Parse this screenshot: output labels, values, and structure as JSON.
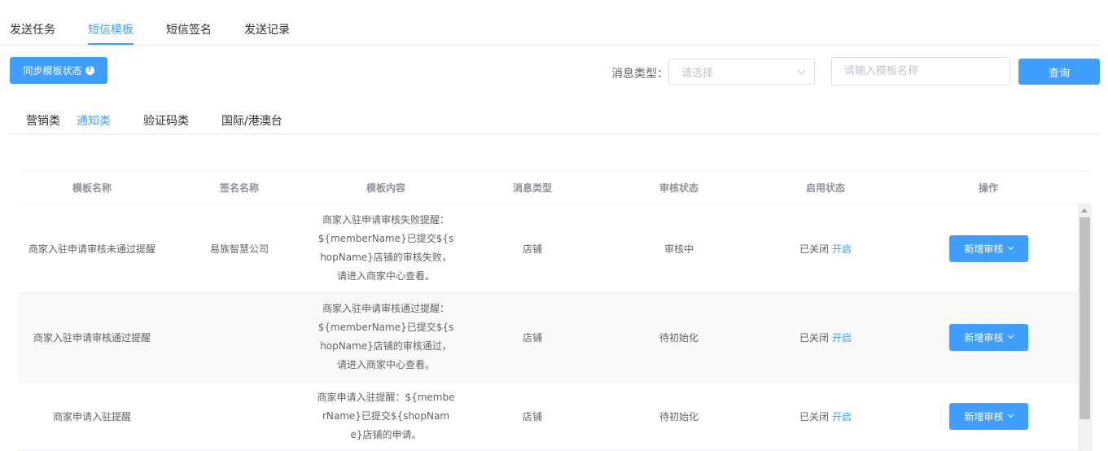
{
  "top_tabs": {
    "items": [
      "发送任务",
      "短信模板",
      "短信签名",
      "发送记录"
    ],
    "active": "短信模板"
  },
  "toolbar": {
    "sync_label": "同步模板状态",
    "sync_help_icon": "question-circle-icon",
    "type_label": "消息类型：",
    "type_placeholder": "请选择",
    "name_placeholder": "请输入模板名称",
    "query_label": "查询"
  },
  "sub_tabs": {
    "items": [
      "营销类",
      "通知类",
      "验证码类",
      "国际/港澳台"
    ],
    "active": "通知类"
  },
  "table": {
    "headers": [
      "模板名称",
      "签名名称",
      "模板内容",
      "消息类型",
      "审核状态",
      "启用状态",
      "操作"
    ],
    "rows": [
      {
        "name": "商家入驻申请审核未通过提醒",
        "signature": "易族智慧公司",
        "content": "商家入驻申请审核失败提醒：${memberName}已提交${shopName}店铺的审核失败，请进入商家中心查看。",
        "msg_type": "店铺",
        "audit_status": "审核中",
        "enable_status": "已关闭",
        "enable_action": "开启",
        "action_label": "新增审核"
      },
      {
        "name": "商家入驻申请审核通过提醒",
        "signature": "",
        "content": "商家入驻申请审核通过提醒：${memberName}已提交${shopName}店铺的审核通过，请进入商家中心查看。",
        "msg_type": "店铺",
        "audit_status": "待初始化",
        "enable_status": "已关闭",
        "enable_action": "开启",
        "action_label": "新增审核"
      },
      {
        "name": "商家申请入驻提醒",
        "signature": "",
        "content": "商家申请入驻提醒：${memberName}已提交${shopName}店铺的申请。",
        "msg_type": "店铺",
        "audit_status": "待初始化",
        "enable_status": "已关闭",
        "enable_action": "开启",
        "action_label": "新增审核"
      }
    ]
  },
  "colors": {
    "primary": "#409eff",
    "text": "#606266",
    "header_text": "#909399",
    "border": "#ebeef5"
  }
}
